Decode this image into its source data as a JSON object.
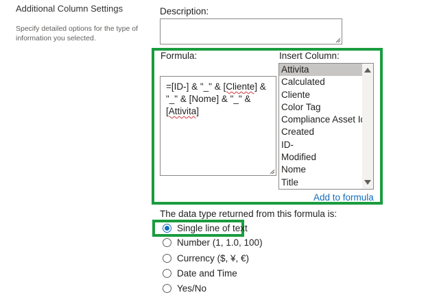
{
  "left": {
    "title": "Additional Column Settings",
    "description": "Specify detailed options for the type of information you selected."
  },
  "description": {
    "label": "Description:",
    "value": ""
  },
  "formula": {
    "label": "Formula:",
    "lines": [
      "=[ID-] & \"_\" & ",
      "[Cliente]",
      " &",
      "\"_\" & [Nome] & \"_\" &",
      "[Attivita]"
    ]
  },
  "insert_column": {
    "label": "Insert Column:",
    "items": [
      "Attivita",
      "Calculated",
      "Cliente",
      "Color Tag",
      "Compliance Asset Id",
      "Created",
      "ID-",
      "Modified",
      "Nome",
      "Title"
    ],
    "selected": "Attivita",
    "add_link": "Add to formula"
  },
  "data_type": {
    "label": "The data type returned from this formula is:",
    "options": [
      "Single line of text",
      "Number (1, 1.0, 100)",
      "Currency ($, ¥, €)",
      "Date and Time",
      "Yes/No"
    ],
    "selected": "Single line of text"
  },
  "colors": {
    "highlight": "#1a9c3f",
    "link": "#0f6cbd",
    "selection": "#c8c6c4"
  }
}
